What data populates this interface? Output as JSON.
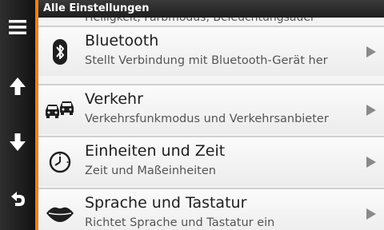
{
  "header": {
    "title": "Alle Einstellungen"
  },
  "partial_item": {
    "subtitle": "Helligkeit, Farbmodus, Beleuchtungsauer"
  },
  "items": [
    {
      "title": "Bluetooth",
      "subtitle": "Stellt Verbindung mit Bluetooth-Gerät her",
      "icon": "bluetooth-icon"
    },
    {
      "title": "Verkehr",
      "subtitle": "Verkehrsfunkmodus und Verkehrsanbieter",
      "icon": "traffic-cars-icon"
    },
    {
      "title": "Einheiten und Zeit",
      "subtitle": "Zeit und Maßeinheiten",
      "icon": "clock-icon"
    },
    {
      "title": "Sprache und Tastatur",
      "subtitle": "Richtet Sprache und Tastatur ein",
      "icon": "lips-icon"
    }
  ],
  "sidebar": {
    "buttons": [
      {
        "icon": "menu-icon"
      },
      {
        "icon": "arrow-up-icon"
      },
      {
        "icon": "arrow-down-icon"
      },
      {
        "icon": "back-icon"
      }
    ]
  },
  "colors": {
    "accent": "#f07d1a",
    "sidebar": "#1c1c1c",
    "list_bg": "#f4f4f4"
  }
}
